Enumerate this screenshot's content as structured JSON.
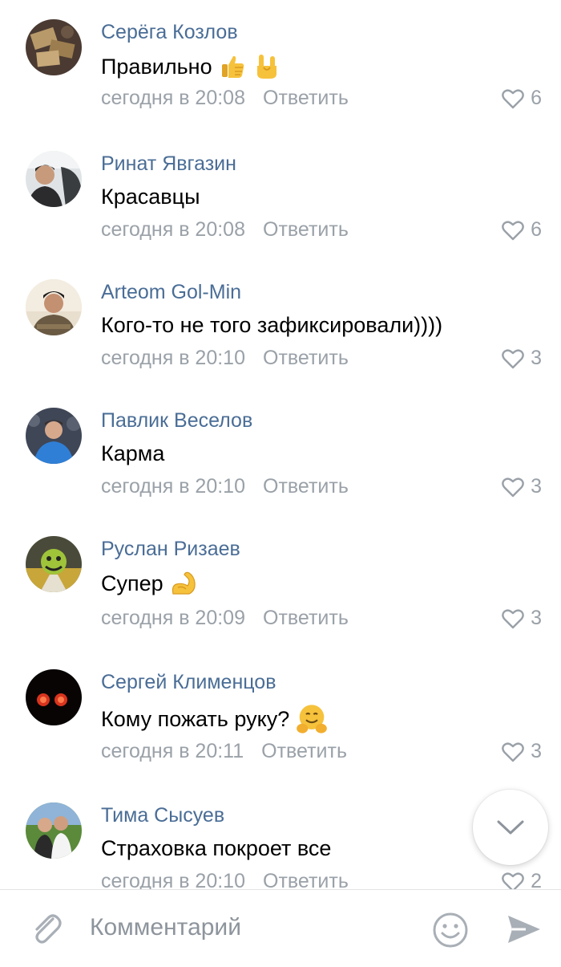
{
  "comments": [
    {
      "author": "Серёга Козлов",
      "text": "Правильно",
      "time": "сегодня в 20:08",
      "reply": "Ответить",
      "likes": "6",
      "emojis": [
        "thumbs-up-emoji",
        "rock-hand-emoji"
      ]
    },
    {
      "author": "Ринат Явгазин",
      "text": "Красавцы",
      "time": "сегодня в 20:08",
      "reply": "Ответить",
      "likes": "6",
      "emojis": []
    },
    {
      "author": "Arteom Gol-Min",
      "text": "Кого-то не того зафиксировали))))",
      "time": "сегодня в 20:10",
      "reply": "Ответить",
      "likes": "3",
      "emojis": []
    },
    {
      "author": "Павлик Веселов",
      "text": "Карма",
      "time": "сегодня в 20:10",
      "reply": "Ответить",
      "likes": "3",
      "emojis": []
    },
    {
      "author": "Руслан Ризаев",
      "text": "Супер",
      "time": "сегодня в 20:09",
      "reply": "Ответить",
      "likes": "3",
      "emojis": [
        "flexed-biceps-emoji"
      ]
    },
    {
      "author": "Сергей Клименцов",
      "text": "Кому пожать руку?",
      "time": "сегодня в 20:11",
      "reply": "Ответить",
      "likes": "3",
      "emojis": [
        "hugging-face-emoji"
      ]
    },
    {
      "author": "Тима Сысуев",
      "text": "Страховка покроет все",
      "time": "сегодня в 20:10",
      "reply": "Ответить",
      "likes": "2",
      "emojis": []
    }
  ],
  "composer": {
    "placeholder": "Комментарий",
    "icons": [
      "paperclip-icon",
      "emoji-smile-icon",
      "send-icon"
    ]
  },
  "scroll_down": {
    "icon": "chevron-down-icon"
  },
  "colors": {
    "author": "#4a6d96",
    "meta": "#9aa1a8",
    "text": "#000000",
    "icon_gray": "#a9afb6"
  }
}
